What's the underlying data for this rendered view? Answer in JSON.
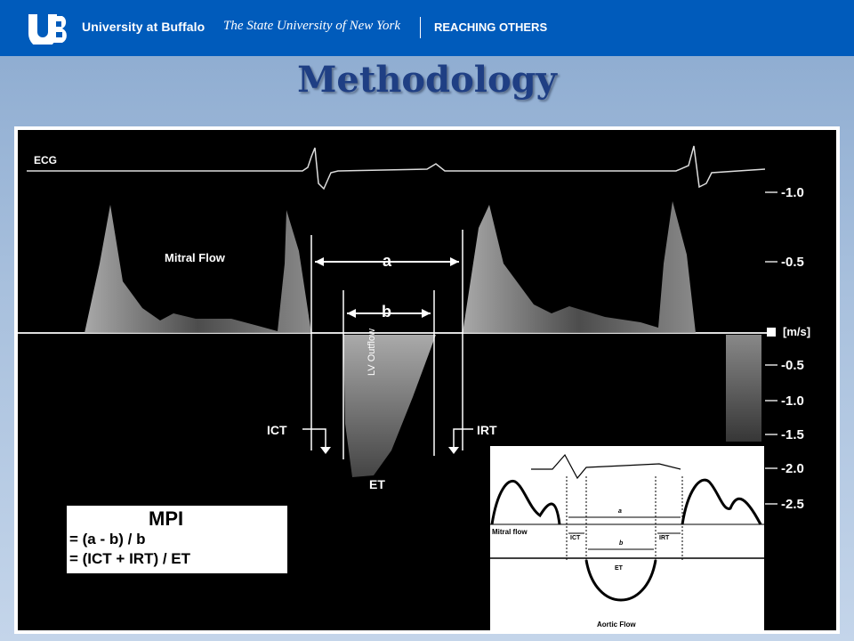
{
  "header": {
    "university_name": "University at Buffalo",
    "suny_name": "The State University of New York",
    "tagline": "REACHING OTHERS"
  },
  "slide": {
    "title": "Methodology"
  },
  "figure": {
    "ecg_label": "ECG",
    "mitral_flow_label": "Mitral Flow",
    "interval_a": "a",
    "interval_b": "b",
    "lv_outflow_label": "LV Outflow",
    "ict_label": "ICT",
    "irt_label": "IRT",
    "et_label": "ET",
    "scale_labels": [
      "-1.0",
      "-0.5",
      "[m/s]",
      "-0.5",
      "-1.0",
      "-1.5",
      "-2.0",
      "-2.5"
    ],
    "mpi_box": {
      "heading": "MPI",
      "line1": "= (a - b) / b",
      "line2": "= (ICT + IRT) / ET"
    },
    "inset": {
      "a": "a",
      "b": "b",
      "mitral_flow": "Mitral flow",
      "ict": "ICT",
      "irt": "IRT",
      "et": "ET",
      "aortic_flow": "Aortic Flow"
    }
  }
}
